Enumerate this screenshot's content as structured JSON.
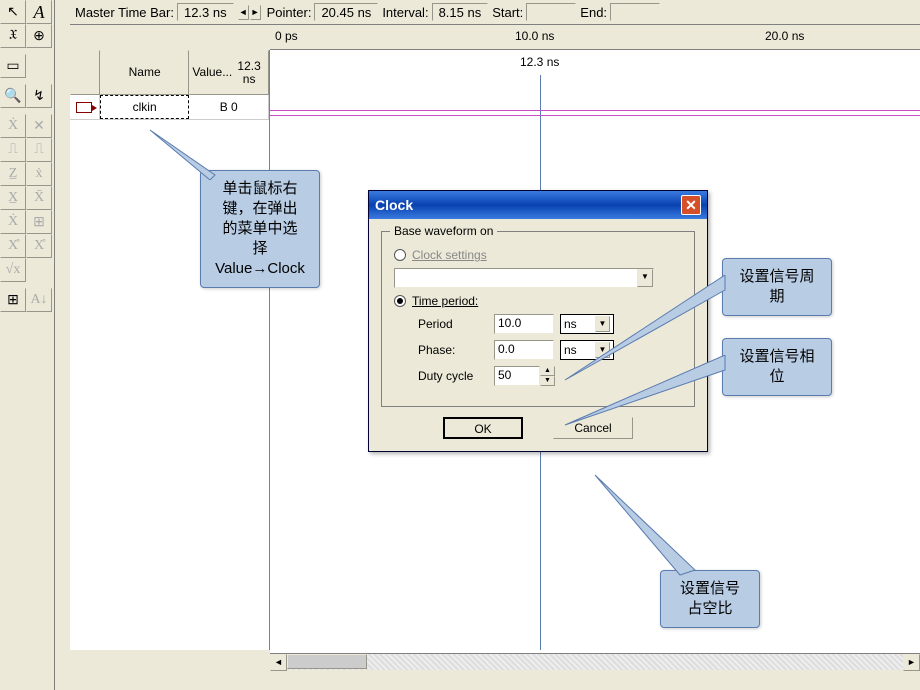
{
  "topbar": {
    "master_label": "Master Time Bar:",
    "master_value": "12.3 ns",
    "pointer_label": "Pointer:",
    "pointer_value": "20.45 ns",
    "interval_label": "Interval:",
    "interval_value": "8.15 ns",
    "start_label": "Start:",
    "start_value": "",
    "end_label": "End:",
    "end_value": ""
  },
  "toolbox": {
    "icons": [
      "pointer",
      "text",
      "zoom-x",
      "zoom-plus",
      "rect",
      "select",
      "binoc",
      "wave-tool",
      "xu",
      "xs",
      "us",
      "ua",
      "z",
      "xw",
      "xl",
      "xh",
      "xr",
      "xx",
      "xc",
      "xo",
      "vx",
      "qr",
      "az"
    ]
  },
  "siglist": {
    "hdr_name": "Name",
    "hdr_value_1": "Value...",
    "hdr_value_2": "12.3 ns",
    "row1_name": "clkin",
    "row1_value": "B 0"
  },
  "ruler": {
    "t0": "0 ps",
    "t1": "10.0 ns",
    "t2": "20.0 ns",
    "cursor": "12.3 ns"
  },
  "dlg": {
    "title": "Clock",
    "group": "Base waveform on",
    "opt_clock": "Clock settings",
    "opt_time": "Time period:",
    "period_label": "Period",
    "period_val": "10.0",
    "period_unit": "ns",
    "phase_label": "Phase:",
    "phase_val": "0.0",
    "phase_unit": "ns",
    "duty_label": "Duty cycle",
    "duty_val": "50",
    "ok": "OK",
    "cancel": "Cancel"
  },
  "callouts": {
    "c1_l1": "单击鼠标右",
    "c1_l2": "键，在弹出",
    "c1_l3": "的菜单中选",
    "c1_l4": "择",
    "c1_l5": "Value→Clock",
    "c2": "设置信号周期",
    "c3": "设置信号相位",
    "c4_l1": "设置信号",
    "c4_l2": "占空比"
  }
}
